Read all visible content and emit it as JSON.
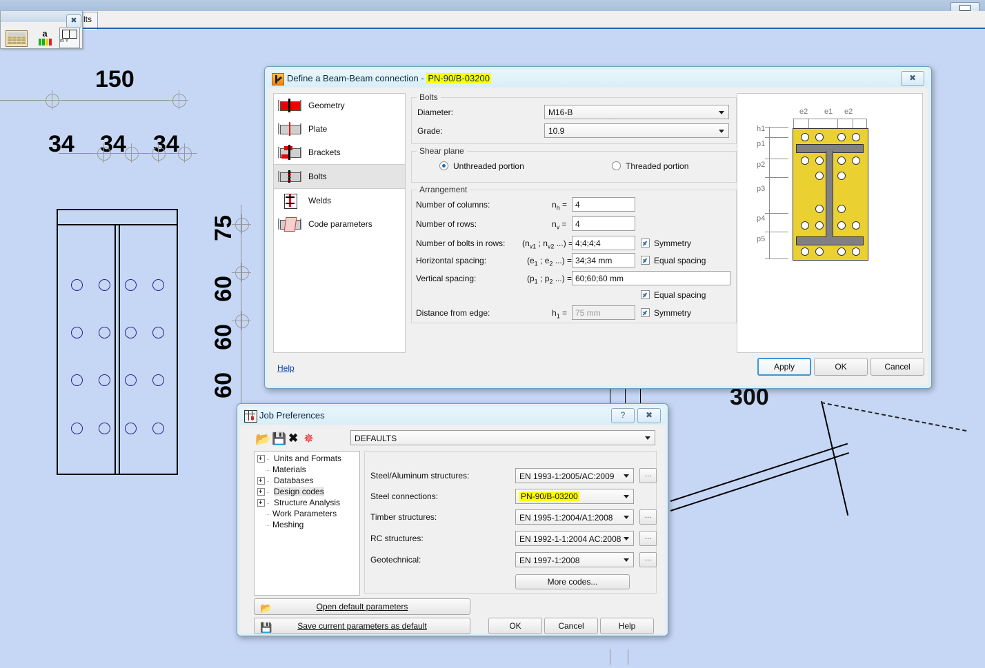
{
  "window": {
    "restore_label": "restore-window",
    "tab_label": "lts"
  },
  "mini_toolbar": {
    "close_label": "✖",
    "calc_icon": "calculator-icon",
    "text_icon": "a",
    "grid_icon": "table-icon",
    "grid_caption": "m    Y"
  },
  "cad": {
    "dimensions_top": [
      "150"
    ],
    "dimensions_horizontal": [
      "34",
      "34",
      "34"
    ],
    "dimensions_vertical": [
      "75",
      "60",
      "60",
      "60"
    ],
    "dimension_partial": "300"
  },
  "connection_dialog": {
    "title_prefix": "Define a Beam-Beam connection - ",
    "title_code": "PN-90/B-03200",
    "close_label": "✖",
    "nav_items": [
      {
        "label": "Geometry",
        "icon": "geometry-icon"
      },
      {
        "label": "Plate",
        "icon": "plate-icon"
      },
      {
        "label": "Brackets",
        "icon": "brackets-icon"
      },
      {
        "label": "Bolts",
        "icon": "bolts-icon"
      },
      {
        "label": "Welds",
        "icon": "welds-icon"
      },
      {
        "label": "Code parameters",
        "icon": "code-parameters-icon"
      }
    ],
    "selected_nav": "Bolts",
    "bolts_group": {
      "caption": "Bolts",
      "diameter_label": "Diameter:",
      "diameter_value": "M16-B",
      "grade_label": "Grade:",
      "grade_value": "10.9"
    },
    "shear_plane_group": {
      "caption": "Shear plane",
      "option_unthreaded": "Unthreaded portion",
      "option_threaded": "Threaded portion",
      "selected": "Unthreaded portion"
    },
    "arrangement_group": {
      "caption": "Arrangement",
      "rows": [
        {
          "label": "Number of columns:",
          "sym": "n",
          "sub": "h",
          "eq": " = ",
          "value": "4",
          "check": null
        },
        {
          "label": "Number of rows:",
          "sym": "n",
          "sub": "v",
          "eq": " = ",
          "value": "4",
          "check": null
        },
        {
          "label": "Number of bolts in rows:",
          "value": "4;4;4;4",
          "check": "Symmetry"
        },
        {
          "label": "Horizontal spacing:",
          "value": "34;34 mm",
          "check": "Equal spacing"
        },
        {
          "label": "Vertical spacing:",
          "value": "60;60;60 mm",
          "check": "Equal spacing"
        },
        {
          "label": "Distance from edge:",
          "sym": "h",
          "sub": "1",
          "eq": " = ",
          "value": "75 mm",
          "check": "Symmetry"
        }
      ],
      "nbolts_symbol": "(n v1 ; n v2 ...) =",
      "hspacing_symbol": "(e 1 ; e 2 ...) =",
      "vspacing_symbol": "(p 1 ; p 2 ...) ="
    },
    "preview": {
      "labels_top": [
        "e2",
        "e1",
        "e2"
      ],
      "labels_left": [
        "h1",
        "p1",
        "p2",
        "p3",
        "p4",
        "p5"
      ]
    },
    "help_link": "Help",
    "buttons": {
      "apply": "Apply",
      "ok": "OK",
      "cancel": "Cancel"
    }
  },
  "job_preferences": {
    "title": "Job Preferences",
    "help_label": "?",
    "close_label": "✖",
    "toolbar": [
      "open-icon",
      "save-icon",
      "delete-icon",
      "new-icon"
    ],
    "profile_combo_value": "DEFAULTS",
    "tree": [
      {
        "label": "Units and Formats",
        "expandable": true,
        "selected": false
      },
      {
        "label": "Materials",
        "expandable": false,
        "selected": false
      },
      {
        "label": "Databases",
        "expandable": true,
        "selected": false
      },
      {
        "label": "Design codes",
        "expandable": true,
        "selected": true
      },
      {
        "label": "Structure Analysis",
        "expandable": true,
        "selected": false
      },
      {
        "label": "Work Parameters",
        "expandable": false,
        "selected": false
      },
      {
        "label": "Meshing",
        "expandable": false,
        "selected": false
      }
    ],
    "codes": [
      {
        "label": "Steel/Aluminum structures:",
        "value": "EN 1993-1:2005/AC:2009",
        "has_dots": true,
        "highlight": false
      },
      {
        "label": "Steel connections:",
        "value": "PN-90/B-03200",
        "has_dots": false,
        "highlight": true
      },
      {
        "label": "Timber structures:",
        "value": "EN 1995-1:2004/A1:2008",
        "has_dots": true,
        "highlight": false
      },
      {
        "label": "RC structures:",
        "value": "EN 1992-1-1:2004 AC:2008",
        "has_dots": true,
        "highlight": false
      },
      {
        "label": "Geotechnical:",
        "value": "EN 1997-1:2008",
        "has_dots": true,
        "highlight": false
      }
    ],
    "more_codes_label": "More codes...",
    "open_defaults_label": "Open default parameters",
    "save_defaults_label": "Save current parameters as default",
    "buttons": {
      "ok": "OK",
      "cancel": "Cancel",
      "help": "Help"
    }
  },
  "colors": {
    "highlight": "#ffff00",
    "desktop": "#c6d7f5",
    "plate_yellow": "#ead131",
    "steel_gray": "#808080",
    "accent_red": "#ee0000",
    "focus_blue": "#3c97d3"
  }
}
